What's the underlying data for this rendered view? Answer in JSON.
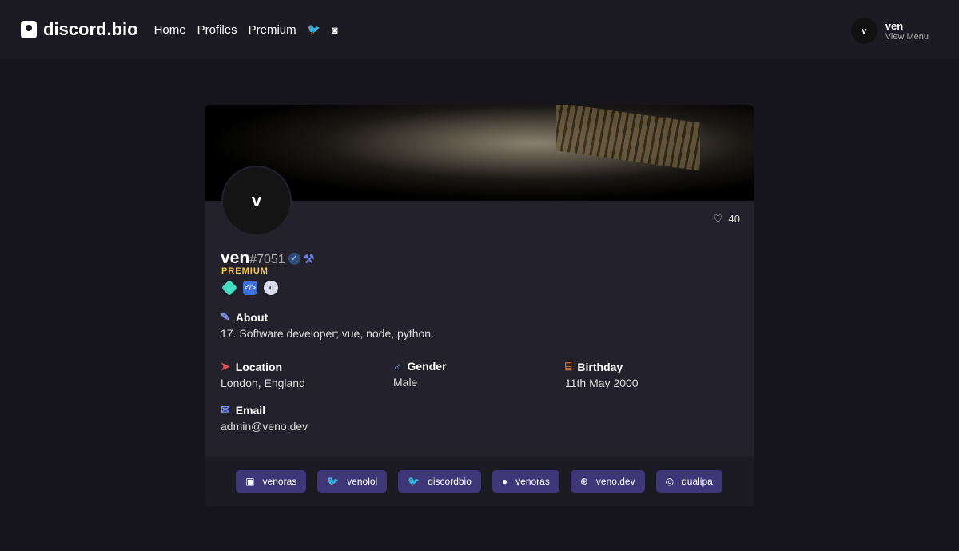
{
  "nav": {
    "brand": "discord.bio",
    "links": [
      "Home",
      "Profiles",
      "Premium"
    ],
    "icons": [
      "twitter-icon",
      "discord-icon"
    ]
  },
  "user": {
    "avatar_letter": "v",
    "name": "ven",
    "menu": "View Menu"
  },
  "profile": {
    "avatar_letter": "v",
    "likes": "40",
    "username": "ven",
    "discriminator": "#7051",
    "tier": "PREMIUM",
    "badges": [
      "hypesquad-balance-icon",
      "verified-developer-icon",
      "nitro-icon"
    ],
    "about_label": "About",
    "about": "17. Software developer; vue, node, python.",
    "location_label": "Location",
    "location": "London, England",
    "gender_label": "Gender",
    "gender": "Male",
    "birthday_label": "Birthday",
    "birthday": "11th May 2000",
    "email_label": "Email",
    "email": "admin@veno.dev"
  },
  "connections": [
    {
      "icon": "twitch-icon",
      "label": "venoras"
    },
    {
      "icon": "twitter-icon",
      "label": "venolol"
    },
    {
      "icon": "twitter-icon",
      "label": "discordbio"
    },
    {
      "icon": "github-icon",
      "label": "venoras"
    },
    {
      "icon": "globe-icon",
      "label": "veno.dev"
    },
    {
      "icon": "instagram-icon",
      "label": "dualipa"
    }
  ],
  "colors": {
    "accent": "#3f3677",
    "premium": "#f2c94c"
  }
}
